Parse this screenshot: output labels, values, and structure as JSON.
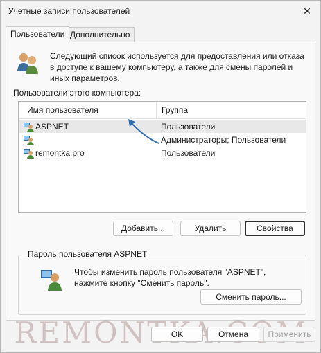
{
  "window": {
    "title": "Учетные записи пользователей",
    "close_icon": "close-icon"
  },
  "tabs": [
    {
      "label": "Пользователи",
      "active": true
    },
    {
      "label": "Дополнительно",
      "active": false
    }
  ],
  "main": {
    "description": "Следующий список используется для предоставления или отказа в доступе к вашему компьютеру, а также для смены паролей и иных параметров.",
    "list_label": "Пользователи этого компьютера:",
    "columns": [
      "Имя пользователя",
      "Группа"
    ],
    "rows": [
      {
        "name": "ASPNET",
        "group": "Пользователи",
        "selected": true
      },
      {
        "name": "",
        "group": "Администраторы; Пользователи",
        "selected": false
      },
      {
        "name": "remontka.pro",
        "group": "Пользователи",
        "selected": false
      }
    ],
    "buttons": {
      "add": "Добавить...",
      "remove": "Удалить",
      "properties": "Свойства"
    }
  },
  "password_group": {
    "title": "Пароль пользователя ASPNET",
    "description": "Чтобы изменить пароль пользователя \"ASPNET\", нажмите кнопку \"Сменить пароль\".",
    "change_button": "Сменить пароль..."
  },
  "footer": {
    "ok": "OK",
    "cancel": "Отмена",
    "apply": "Применить"
  },
  "watermark": "REMONTKA.COM",
  "colors": {
    "arrow": "#2f6fb0",
    "selection": "#e8e8e8"
  }
}
